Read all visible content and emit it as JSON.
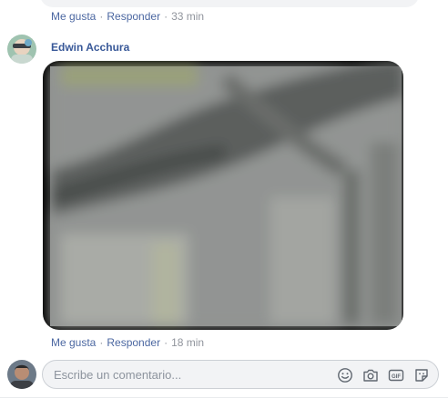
{
  "previous_comment": {
    "actions": {
      "like": "Me gusta",
      "reply": "Responder",
      "time": "33 min",
      "separator": "·"
    }
  },
  "comment": {
    "author": "Edwin Acchura",
    "actions": {
      "like": "Me gusta",
      "reply": "Responder",
      "time": "18 min",
      "separator": "·"
    }
  },
  "composer": {
    "placeholder": "Escribe un comentario...",
    "icons": [
      "emoji-icon",
      "camera-icon",
      "gif-icon",
      "sticker-icon"
    ]
  },
  "colors": {
    "link": "#4b67a1",
    "author": "#385898",
    "muted": "#90949c",
    "bubble": "#f2f3f5"
  }
}
